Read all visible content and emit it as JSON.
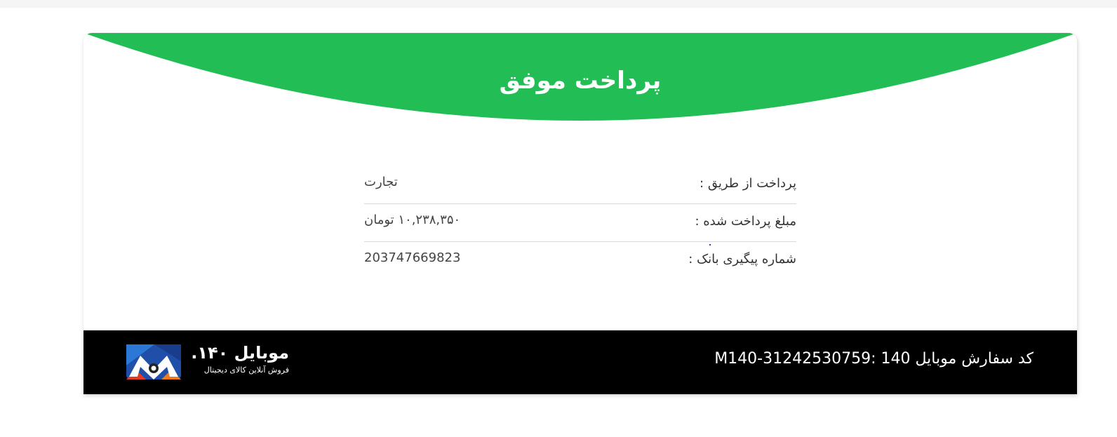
{
  "header": {
    "title": "پرداخت موفق",
    "accent_color": "#22bd55"
  },
  "details": [
    {
      "label": "پرداخت از طریق :",
      "value": "تجارت"
    },
    {
      "label": "مبلغ پرداخت شده :",
      "value": "۱۰,۲۳۸,۳۵۰ تومان"
    },
    {
      "label": "شماره پیگیری بانک :",
      "value": "203747669823"
    }
  ],
  "footer": {
    "order_code": "کد سفارش موبایل 140 :M140-31242530759",
    "logo_name": "موبایل ۱۴۰.",
    "logo_tagline": "فروش آنلاین کالای دیجیتال",
    "logo_icon": "mobile140-logo-icon"
  }
}
